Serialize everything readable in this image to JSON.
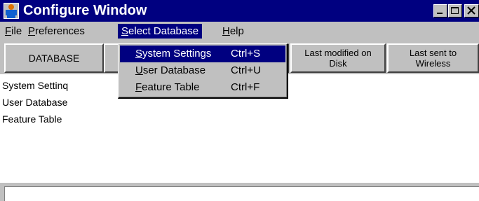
{
  "window": {
    "title": "Configure Window",
    "controls": {
      "minimize": "minimize",
      "maximize": "maximize",
      "close": "close"
    }
  },
  "menubar": {
    "items": [
      {
        "pre": "",
        "ul": "F",
        "post": "ile"
      },
      {
        "pre": "",
        "ul": "P",
        "post": "references"
      },
      {
        "pre": "",
        "ul": "S",
        "post": "elect Database"
      },
      {
        "pre": "",
        "ul": "H",
        "post": "elp"
      }
    ]
  },
  "dropdown": {
    "items": [
      {
        "ul": "S",
        "post": "ystem Settings",
        "shortcut": "Ctrl+S"
      },
      {
        "ul": "U",
        "post": "ser Database",
        "shortcut": "Ctrl+U"
      },
      {
        "ul": "F",
        "post": "eature Table",
        "shortcut": "Ctrl+F"
      }
    ]
  },
  "headers": {
    "database": "DATABASE",
    "last_modified_disk": "Last modified on\nDisk",
    "last_sent_wireless": "Last sent to\nWireless"
  },
  "rows": [
    "System Settinq",
    "User Database",
    "Feature Table"
  ],
  "colors": {
    "titlebar": "#000080",
    "face": "#c0c0c0",
    "highlight": "#000080"
  }
}
